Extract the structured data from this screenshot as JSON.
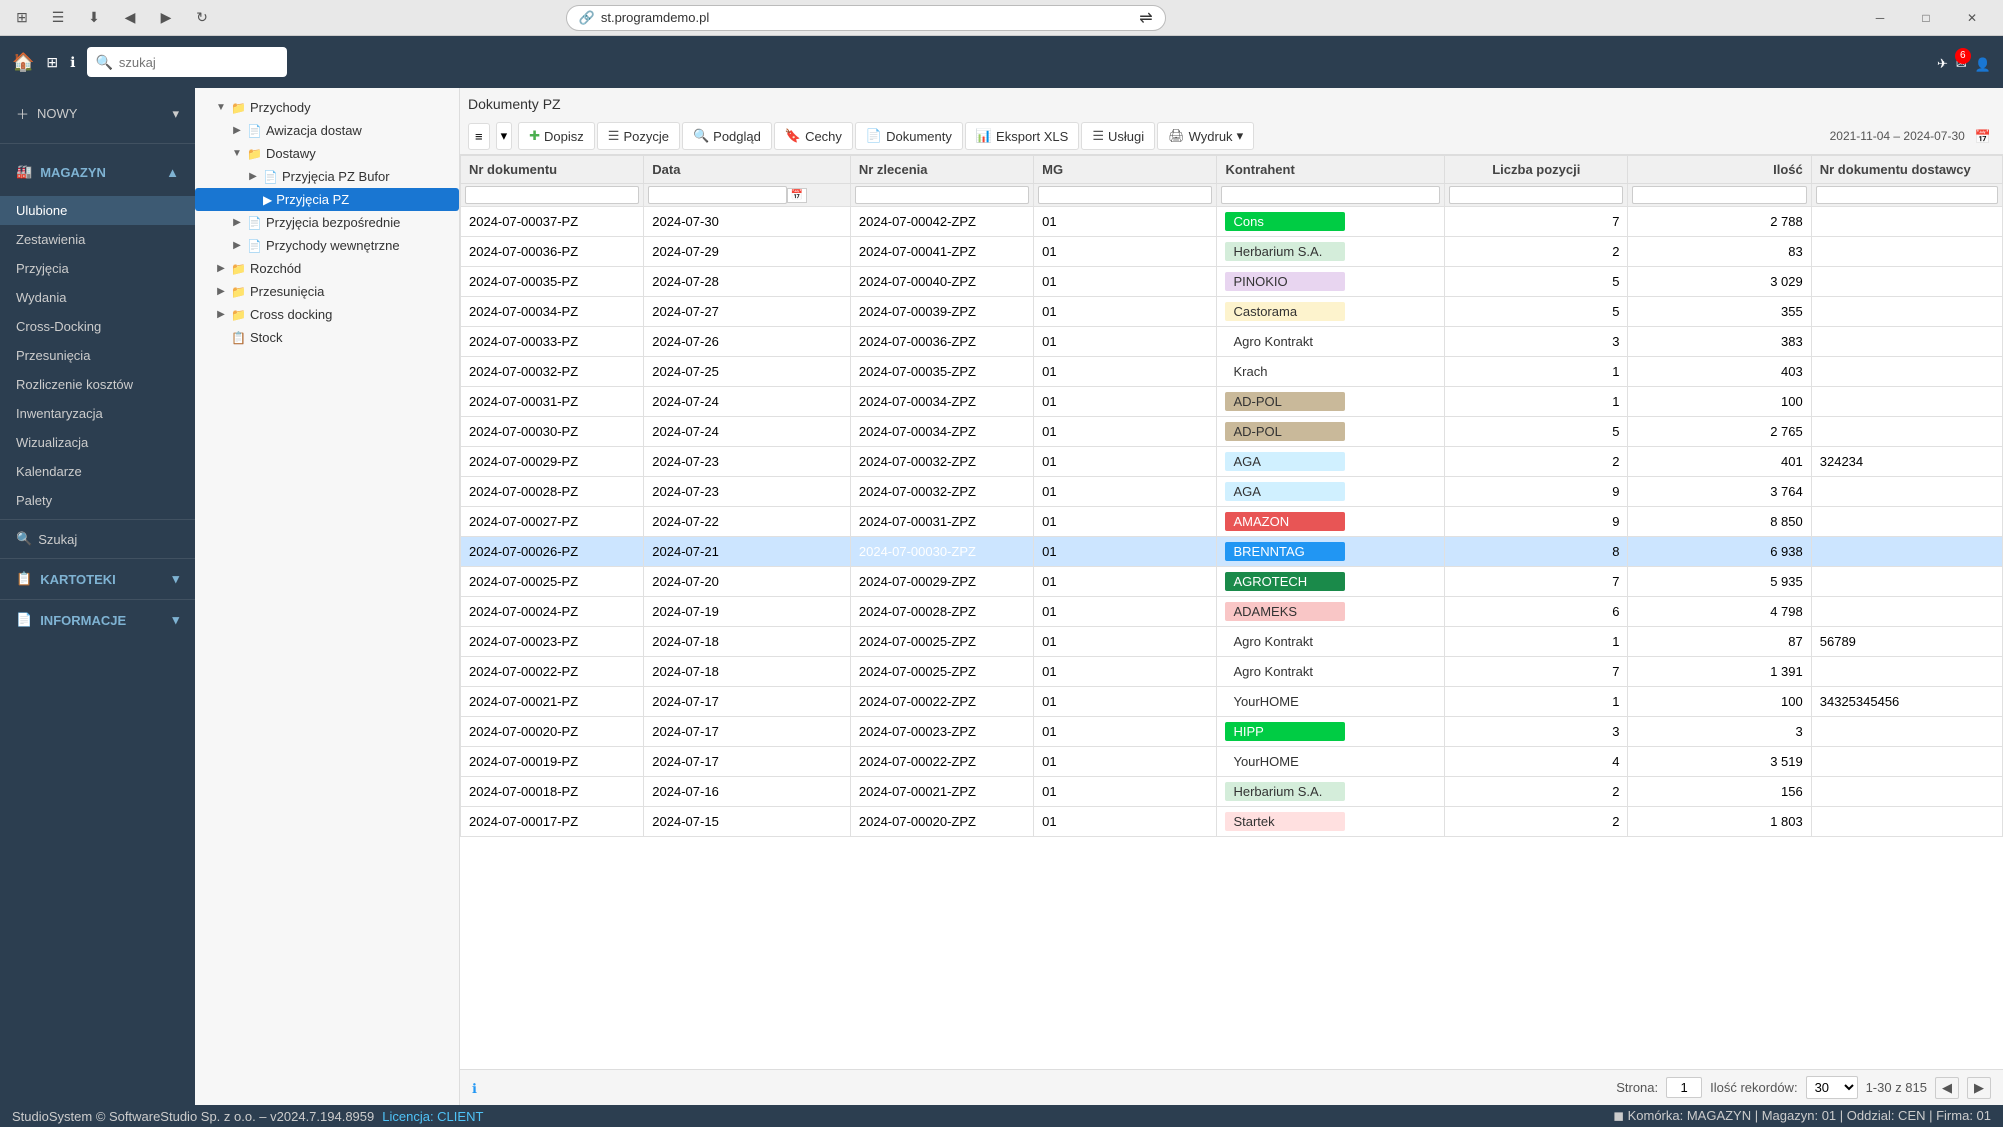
{
  "browser": {
    "url": "st.programdemo.pl",
    "nav_back": "◀",
    "nav_forward": "▶",
    "nav_refresh": "↻",
    "win_min": "─",
    "win_max": "□",
    "win_close": "✕"
  },
  "topbar": {
    "search_placeholder": "szukaj",
    "notification_count": "6",
    "plane_icon": "✈"
  },
  "sidebar": {
    "nowy_label": "NOWY",
    "magazyn_label": "MAGAZYN",
    "items": [
      {
        "id": "ulubione",
        "label": "Ulubione",
        "active": true
      },
      {
        "id": "zestawienia",
        "label": "Zestawienia",
        "active": false
      },
      {
        "id": "przyjecia",
        "label": "Przyjęcia",
        "active": false
      },
      {
        "id": "wydania",
        "label": "Wydania",
        "active": false
      },
      {
        "id": "cross-docking",
        "label": "Cross-Docking",
        "active": false
      },
      {
        "id": "przesunecia",
        "label": "Przesunięcia",
        "active": false
      },
      {
        "id": "rozliczenie-kosztow",
        "label": "Rozliczenie kosztów",
        "active": false
      },
      {
        "id": "inwentaryzacja",
        "label": "Inwentaryzacja",
        "active": false
      },
      {
        "id": "wizualizacja",
        "label": "Wizualizacja",
        "active": false
      },
      {
        "id": "kalendarze",
        "label": "Kalendarze",
        "active": false
      },
      {
        "id": "palety",
        "label": "Palety",
        "active": false
      }
    ],
    "szukaj_label": "Szukaj",
    "kartoteki_label": "KARTOTEKI",
    "informacje_label": "INFORMACJE"
  },
  "tree": {
    "items": [
      {
        "id": "przychody",
        "label": "Przychody",
        "level": 1,
        "expanded": true,
        "has_toggle": true,
        "active": false
      },
      {
        "id": "awizacja-dostaw",
        "label": "Awizacja dostaw",
        "level": 2,
        "expanded": false,
        "has_toggle": true,
        "active": false
      },
      {
        "id": "dostawy",
        "label": "Dostawy",
        "level": 2,
        "expanded": true,
        "has_toggle": true,
        "active": false
      },
      {
        "id": "przyjecia-pz-bufor",
        "label": "Przyjęcia PZ Bufor",
        "level": 3,
        "expanded": false,
        "has_toggle": true,
        "active": false
      },
      {
        "id": "przyjecia-pz",
        "label": "Przyjęcia PZ",
        "level": 3,
        "expanded": false,
        "has_toggle": false,
        "active": true
      },
      {
        "id": "przyjecia-bezposrednie",
        "label": "Przyjęcia bezpośrednie",
        "level": 2,
        "expanded": false,
        "has_toggle": true,
        "active": false
      },
      {
        "id": "przychody-wewnetrzne",
        "label": "Przychody wewnętrzne",
        "level": 2,
        "expanded": false,
        "has_toggle": true,
        "active": false
      },
      {
        "id": "rozchod",
        "label": "Rozchód",
        "level": 1,
        "expanded": false,
        "has_toggle": true,
        "active": false
      },
      {
        "id": "przesunecia",
        "label": "Przesunięcia",
        "level": 1,
        "expanded": false,
        "has_toggle": true,
        "active": false
      },
      {
        "id": "cross-docking",
        "label": "Cross docking",
        "level": 1,
        "expanded": false,
        "has_toggle": true,
        "active": false
      },
      {
        "id": "stock",
        "label": "Stock",
        "level": 1,
        "expanded": false,
        "has_toggle": false,
        "active": false
      }
    ]
  },
  "content": {
    "title": "Dokumenty PZ",
    "toolbar": {
      "menu_icon": "≡",
      "dopisz": "Dopisz",
      "pozycje": "Pozycje",
      "podglad": "Podgląd",
      "cechy": "Cechy",
      "dokumenty": "Dokumenty",
      "eksport_xls": "Eksport XLS",
      "uslugi": "Usługi",
      "wydruk": "Wydruk",
      "date_range": "2021-11-04 – 2024-07-30",
      "calendar_icon": "📅"
    },
    "table": {
      "columns": [
        {
          "id": "nr_dokumentu",
          "label": "Nr dokumentu"
        },
        {
          "id": "data",
          "label": "Data"
        },
        {
          "id": "nr_zlecenia",
          "label": "Nr zlecenia"
        },
        {
          "id": "mg",
          "label": "MG"
        },
        {
          "id": "kontrahent",
          "label": "Kontrahent"
        },
        {
          "id": "liczba_pozycji",
          "label": "Liczba pozycji"
        },
        {
          "id": "ilosc",
          "label": "Ilość"
        },
        {
          "id": "nr_dokumentu_dostawcy",
          "label": "Nr dokumentu dostawcy"
        }
      ],
      "rows": [
        {
          "nr": "2024-07-00037-PZ",
          "data": "2024-07-30",
          "zlecenie": "2024-07-00042-ZPZ",
          "mg": "01",
          "kontrahent": "Cons",
          "kontrahent_bg": "#00cc44",
          "kontrahent_color": "#ffffff",
          "pozycji": "7",
          "ilosc": "2 788",
          "dok_dostawcy": ""
        },
        {
          "nr": "2024-07-00036-PZ",
          "data": "2024-07-29",
          "zlecenie": "2024-07-00041-ZPZ",
          "mg": "01",
          "kontrahent": "Herbarium S.A.",
          "kontrahent_bg": "#d4edda",
          "kontrahent_color": "#333",
          "pozycji": "2",
          "ilosc": "83",
          "dok_dostawcy": ""
        },
        {
          "nr": "2024-07-00035-PZ",
          "data": "2024-07-28",
          "zlecenie": "2024-07-00040-ZPZ",
          "mg": "01",
          "kontrahent": "PINOKIO",
          "kontrahent_bg": "#e8d5f0",
          "kontrahent_color": "#333",
          "pozycji": "5",
          "ilosc": "3 029",
          "dok_dostawcy": ""
        },
        {
          "nr": "2024-07-00034-PZ",
          "data": "2024-07-27",
          "zlecenie": "2024-07-00039-ZPZ",
          "mg": "01",
          "kontrahent": "Castorama",
          "kontrahent_bg": "#fdf3cd",
          "kontrahent_color": "#333",
          "pozycji": "5",
          "ilosc": "355",
          "dok_dostawcy": ""
        },
        {
          "nr": "2024-07-00033-PZ",
          "data": "2024-07-26",
          "zlecenie": "2024-07-00036-ZPZ",
          "mg": "01",
          "kontrahent": "Agro Kontrakt",
          "kontrahent_bg": "#ffffff",
          "kontrahent_color": "#333",
          "pozycji": "3",
          "ilosc": "383",
          "dok_dostawcy": ""
        },
        {
          "nr": "2024-07-00032-PZ",
          "data": "2024-07-25",
          "zlecenie": "2024-07-00035-ZPZ",
          "mg": "01",
          "kontrahent": "Krach",
          "kontrahent_bg": "#ffffff",
          "kontrahent_color": "#333",
          "pozycji": "1",
          "ilosc": "403",
          "dok_dostawcy": ""
        },
        {
          "nr": "2024-07-00031-PZ",
          "data": "2024-07-24",
          "zlecenie": "2024-07-00034-ZPZ",
          "mg": "01",
          "kontrahent": "AD-POL",
          "kontrahent_bg": "#c9b99a",
          "kontrahent_color": "#333",
          "pozycji": "1",
          "ilosc": "100",
          "dok_dostawcy": ""
        },
        {
          "nr": "2024-07-00030-PZ",
          "data": "2024-07-24",
          "zlecenie": "2024-07-00034-ZPZ",
          "mg": "01",
          "kontrahent": "AD-POL",
          "kontrahent_bg": "#c9b99a",
          "kontrahent_color": "#333",
          "pozycji": "5",
          "ilosc": "2 765",
          "dok_dostawcy": ""
        },
        {
          "nr": "2024-07-00029-PZ",
          "data": "2024-07-23",
          "zlecenie": "2024-07-00032-ZPZ",
          "mg": "01",
          "kontrahent": "AGA",
          "kontrahent_bg": "#d0f0ff",
          "kontrahent_color": "#333",
          "pozycji": "2",
          "ilosc": "401",
          "dok_dostawcy": "324234"
        },
        {
          "nr": "2024-07-00028-PZ",
          "data": "2024-07-23",
          "zlecenie": "2024-07-00032-ZPZ",
          "mg": "01",
          "kontrahent": "AGA",
          "kontrahent_bg": "#d0f0ff",
          "kontrahent_color": "#333",
          "pozycji": "9",
          "ilosc": "3 764",
          "dok_dostawcy": ""
        },
        {
          "nr": "2024-07-00027-PZ",
          "data": "2024-07-22",
          "zlecenie": "2024-07-00031-ZPZ",
          "mg": "01",
          "kontrahent": "AMAZON",
          "kontrahent_bg": "#e85555",
          "kontrahent_color": "#ffffff",
          "pozycji": "9",
          "ilosc": "8 850",
          "dok_dostawcy": ""
        },
        {
          "nr": "2024-07-00026-PZ",
          "data": "2024-07-21",
          "zlecenie": "2024-07-00030-ZPZ",
          "mg": "01",
          "kontrahent": "BRENNTAG",
          "kontrahent_bg": "#2196F3",
          "kontrahent_color": "#ffffff",
          "pozycji": "8",
          "ilosc": "6 938",
          "dok_dostawcy": "",
          "selected": true
        },
        {
          "nr": "2024-07-00025-PZ",
          "data": "2024-07-20",
          "zlecenie": "2024-07-00029-ZPZ",
          "mg": "01",
          "kontrahent": "AGROTECH",
          "kontrahent_bg": "#1a8a4a",
          "kontrahent_color": "#ffffff",
          "pozycji": "7",
          "ilosc": "5 935",
          "dok_dostawcy": ""
        },
        {
          "nr": "2024-07-00024-PZ",
          "data": "2024-07-19",
          "zlecenie": "2024-07-00028-ZPZ",
          "mg": "01",
          "kontrahent": "ADAMEKS",
          "kontrahent_bg": "#f9c6c6",
          "kontrahent_color": "#333",
          "pozycji": "6",
          "ilosc": "4 798",
          "dok_dostawcy": ""
        },
        {
          "nr": "2024-07-00023-PZ",
          "data": "2024-07-18",
          "zlecenie": "2024-07-00025-ZPZ",
          "mg": "01",
          "kontrahent": "Agro Kontrakt",
          "kontrahent_bg": "#ffffff",
          "kontrahent_color": "#333",
          "pozycji": "1",
          "ilosc": "87",
          "dok_dostawcy": "56789"
        },
        {
          "nr": "2024-07-00022-PZ",
          "data": "2024-07-18",
          "zlecenie": "2024-07-00025-ZPZ",
          "mg": "01",
          "kontrahent": "Agro Kontrakt",
          "kontrahent_bg": "#ffffff",
          "kontrahent_color": "#333",
          "pozycji": "7",
          "ilosc": "1 391",
          "dok_dostawcy": ""
        },
        {
          "nr": "2024-07-00021-PZ",
          "data": "2024-07-17",
          "zlecenie": "2024-07-00022-ZPZ",
          "mg": "01",
          "kontrahent": "YourHOME",
          "kontrahent_bg": "#ffffff",
          "kontrahent_color": "#333",
          "pozycji": "1",
          "ilosc": "100",
          "dok_dostawcy": "34325345456"
        },
        {
          "nr": "2024-07-00020-PZ",
          "data": "2024-07-17",
          "zlecenie": "2024-07-00023-ZPZ",
          "mg": "01",
          "kontrahent": "HIPP",
          "kontrahent_bg": "#00cc44",
          "kontrahent_color": "#ffffff",
          "pozycji": "3",
          "ilosc": "3",
          "dok_dostawcy": ""
        },
        {
          "nr": "2024-07-00019-PZ",
          "data": "2024-07-17",
          "zlecenie": "2024-07-00022-ZPZ",
          "mg": "01",
          "kontrahent": "YourHOME",
          "kontrahent_bg": "#ffffff",
          "kontrahent_color": "#333",
          "pozycji": "4",
          "ilosc": "3 519",
          "dok_dostawcy": ""
        },
        {
          "nr": "2024-07-00018-PZ",
          "data": "2024-07-16",
          "zlecenie": "2024-07-00021-ZPZ",
          "mg": "01",
          "kontrahent": "Herbarium S.A.",
          "kontrahent_bg": "#d4edda",
          "kontrahent_color": "#333",
          "pozycji": "2",
          "ilosc": "156",
          "dok_dostawcy": ""
        },
        {
          "nr": "2024-07-00017-PZ",
          "data": "2024-07-15",
          "zlecenie": "2024-07-00020-ZPZ",
          "mg": "01",
          "kontrahent": "Startek",
          "kontrahent_bg": "#ffe0e0",
          "kontrahent_color": "#333",
          "pozycji": "2",
          "ilosc": "1 803",
          "dok_dostawcy": ""
        }
      ]
    },
    "footer": {
      "info_icon": "ℹ",
      "strona_label": "Strona:",
      "page_num": "1",
      "ilosc_rekordow_label": "Ilość rekordów:",
      "records_value": "30",
      "records_range": "1-30 z 815",
      "nav_prev": "◀",
      "nav_next": "▶"
    }
  },
  "status_bar": {
    "copyright": "StudioSystem © SoftwareStudio Sp. z o.o. – v2024.7.194.8959",
    "license_label": "Licencja: CLIENT",
    "right_info": "◼ Komórka: MAGAZYN | Magazyn: 01 | Oddzial: CEN | Firma: 01"
  }
}
